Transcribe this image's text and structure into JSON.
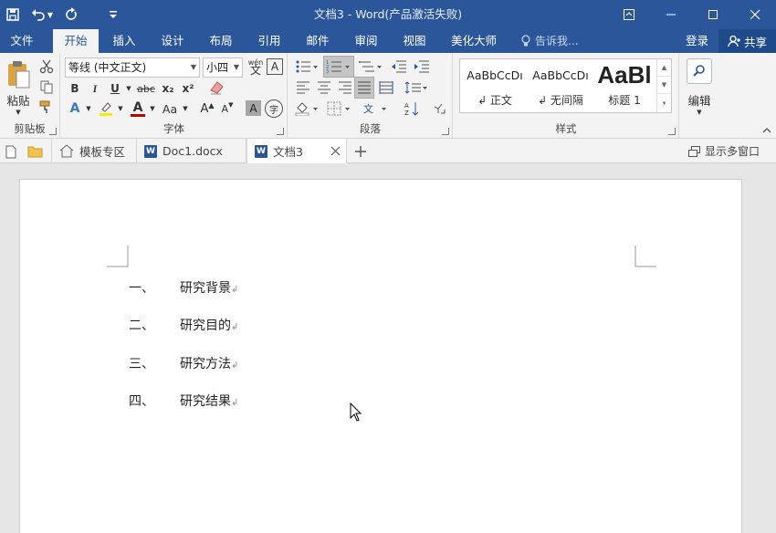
{
  "window": {
    "title": "文档3 - Word(产品激活失败)"
  },
  "tabs": [
    {
      "label": "文件"
    },
    {
      "label": "开始"
    },
    {
      "label": "插入"
    },
    {
      "label": "设计"
    },
    {
      "label": "布局"
    },
    {
      "label": "引用"
    },
    {
      "label": "邮件"
    },
    {
      "label": "审阅"
    },
    {
      "label": "视图"
    },
    {
      "label": "美化大师"
    }
  ],
  "tellme": {
    "label": "告诉我..."
  },
  "account": {
    "login": "登录",
    "share": "共享"
  },
  "ribbon": {
    "clipboard": {
      "label": "剪贴板",
      "paste": "粘贴"
    },
    "font": {
      "label": "字体",
      "font_name": "等线 (中文正文)",
      "font_size": "小四",
      "wen_label": "wén",
      "bold": "B",
      "italic": "I",
      "underline": "U",
      "strike": "abc",
      "sub": "x₂",
      "sup": "x²",
      "texteffect": "A",
      "fontcolor": "A",
      "changecase": "Aa",
      "grow": "A",
      "shrink": "A",
      "charshade": "A",
      "enclose": "字",
      "border": "A"
    },
    "paragraph": {
      "label": "段落"
    },
    "styles": {
      "label": "样式",
      "items": [
        {
          "sample": "AaBbCcDı",
          "name": "↲ 正文"
        },
        {
          "sample": "AaBbCcDı",
          "name": "↲ 无间隔"
        },
        {
          "sample": "AaBl",
          "name": "标题 1"
        }
      ]
    },
    "editing": {
      "label": "编辑"
    }
  },
  "doctabs": [
    {
      "label": "模板专区"
    },
    {
      "label": "Doc1.docx"
    },
    {
      "label": "文档3"
    }
  ],
  "multiwindow": {
    "label": "显示多窗口"
  },
  "document": {
    "items": [
      {
        "num": "一、",
        "text": "研究背景"
      },
      {
        "num": "二、",
        "text": "研究目的"
      },
      {
        "num": "三、",
        "text": "研究方法"
      },
      {
        "num": "四、",
        "text": "研究结果"
      }
    ],
    "para_mark": "↲"
  },
  "colors": {
    "accent": "#2b579a",
    "ribbon_bg": "#f3f3f3",
    "workspace": "#e6e6e6"
  }
}
